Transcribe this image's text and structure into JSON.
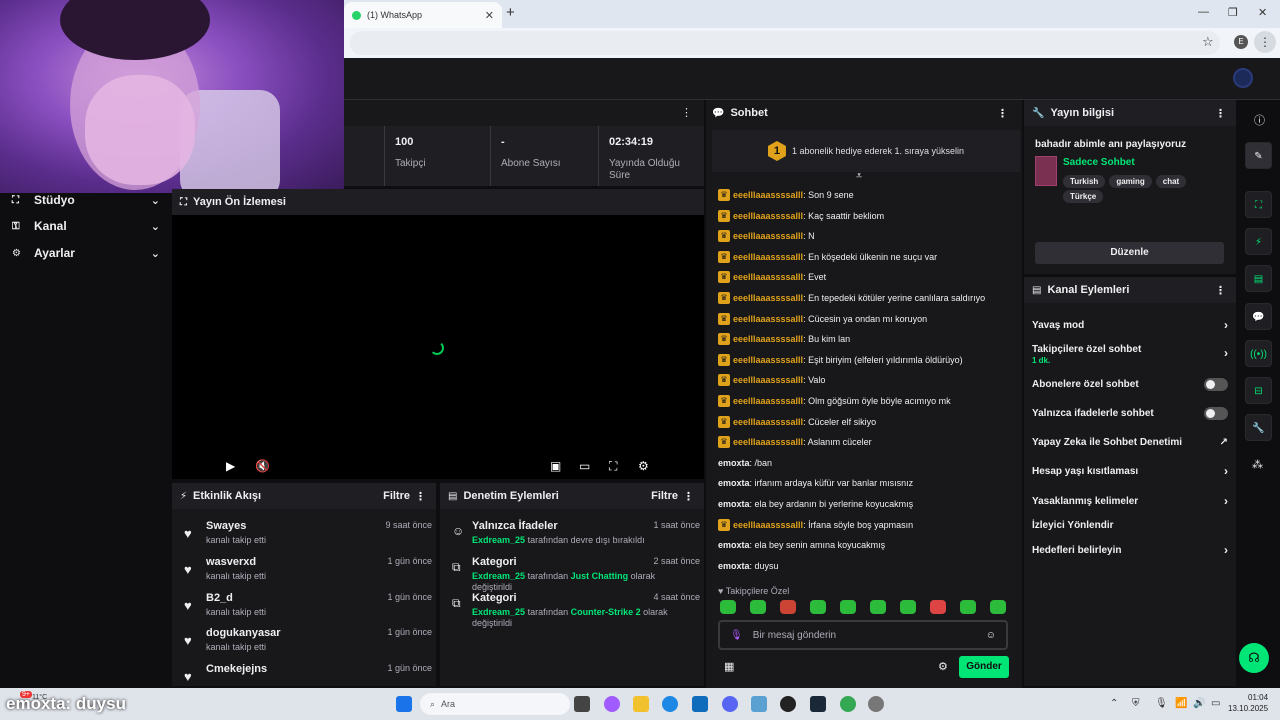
{
  "browser": {
    "tab_title": "(1) WhatsApp",
    "tab_close": "✕",
    "new_tab": "+",
    "minimize": "—",
    "restore": "❐",
    "close": "✕",
    "profile_initial": "E"
  },
  "sidebar": {
    "items": [
      {
        "label": "Stüdyo",
        "icon": "studio-icon"
      },
      {
        "label": "Kanal",
        "icon": "channel-icon"
      },
      {
        "label": "Ayarlar",
        "icon": "gear-icon"
      }
    ]
  },
  "stats": [
    {
      "value": "100",
      "label": "Takipçi"
    },
    {
      "value": "-",
      "label": "Abone Sayısı"
    },
    {
      "value": "02:34:19",
      "label": "Yayında Olduğu Süre"
    }
  ],
  "preview": {
    "title": "Yayın Ön İzlemesi"
  },
  "event_feed": {
    "title": "Etkinlik Akışı",
    "filter": "Filtre",
    "events": [
      {
        "name": "Swayes",
        "sub": "kanalı takip etti",
        "time": "9 saat önce"
      },
      {
        "name": "wasverxd",
        "sub": "kanalı takip etti",
        "time": "1 gün önce"
      },
      {
        "name": "B2_d",
        "sub": "kanalı takip etti",
        "time": "1 gün önce"
      },
      {
        "name": "dogukanyasar",
        "sub": "kanalı takip etti",
        "time": "1 gün önce"
      },
      {
        "name": "Cmekejejns",
        "sub": "",
        "time": "1 gün önce"
      }
    ]
  },
  "mod_actions": {
    "title": "Denetim Eylemleri",
    "filter": "Filtre",
    "items": [
      {
        "name": "Yalnızca İfadeler",
        "user": "Exdream_25",
        "text": "tarafından devre dışı bırakıldı",
        "extra": "",
        "extra2": "",
        "time": "1 saat önce"
      },
      {
        "name": "Kategori",
        "user": "Exdream_25",
        "text": "tarafından",
        "extra": "Just Chatting",
        "extra2": "olarak değiştirildi",
        "time": "2 saat önce"
      },
      {
        "name": "Kategori",
        "user": "Exdream_25",
        "text": "tarafından",
        "extra": "Counter-Strike 2",
        "extra2": "olarak değiştirildi",
        "time": "4 saat önce"
      }
    ]
  },
  "chat": {
    "title": "Sohbet",
    "banner_count": "1",
    "banner_text": "1 abonelik hediye ederek 1. sıraya yükselin",
    "messages": [
      {
        "user": "eeelllaaassssalll",
        "text": ": Son 9 sene",
        "sub": true
      },
      {
        "user": "eeelllaaassssalll",
        "text": ": Kaç saattir bekliom",
        "sub": true
      },
      {
        "user": "eeelllaaassssalll",
        "text": ": N",
        "sub": true
      },
      {
        "user": "eeelllaaassssalll",
        "text": ": En köşedeki ülkenin ne suçu var",
        "sub": true
      },
      {
        "user": "eeelllaaassssalll",
        "text": ": Evet",
        "sub": true
      },
      {
        "user": "eeelllaaassssalll",
        "text": ": En tepedeki kötüler yerine canlılara saldırıyo",
        "sub": true
      },
      {
        "user": "eeelllaaassssalll",
        "text": ": Cücesin ya ondan mı koruyon",
        "sub": true
      },
      {
        "user": "eeelllaaassssalll",
        "text": ": Bu kim lan",
        "sub": true
      },
      {
        "user": "eeelllaaassssalll",
        "text": ": Eşit biriyim (elfeleri yıldırımla öldürüyo)",
        "sub": true
      },
      {
        "user": "eeelllaaassssalll",
        "text": ": Valo",
        "sub": true
      },
      {
        "user": "eeelllaaassssalll",
        "text": ": Olm göğsüm öyle böyle acımıyo mk",
        "sub": true
      },
      {
        "user": "eeelllaaassssalll",
        "text": ": Cüceler elf sikiyo",
        "sub": true
      },
      {
        "user": "eeelllaaassssalll",
        "text": ": Aslanım cüceler",
        "sub": true
      },
      {
        "user": "emoxta",
        "text": ": /ban",
        "sub": false
      },
      {
        "user": "emoxta",
        "text": ": irfanım ardaya küfür var banlar mısısnız",
        "sub": false
      },
      {
        "user": "emoxta",
        "text": ": ela bey ardanın bi yerlerine koyucakmış",
        "sub": false
      },
      {
        "user": "eeelllaaassssalll",
        "text": ": İrfana söyle boş yapmasın",
        "sub": true
      },
      {
        "user": "emoxta",
        "text": ": ela bey senin amına koyucakmış",
        "sub": false
      },
      {
        "user": "emoxta",
        "text": ": duysu",
        "sub": false
      }
    ],
    "followers_only": "Takipçilere Özel",
    "placeholder": "Bir mesaj gönderin",
    "send": "Gönder"
  },
  "stream_info": {
    "title": "Yayın bilgisi",
    "stream_title": "bahadır abimle anı paylaşıyoruz",
    "category": "Sadece Sohbet",
    "tags": [
      "Turkish",
      "gaming",
      "chat",
      "Türkçe"
    ],
    "edit": "Düzenle"
  },
  "channel_actions": {
    "title": "Kanal Eylemleri",
    "rows": [
      {
        "label": "Yavaş mod",
        "kind": "chevron"
      },
      {
        "label": "Takipçilere özel sohbet",
        "kind": "chevron",
        "sub": "1 dk."
      },
      {
        "label": "Abonelere özel sohbet",
        "kind": "toggle"
      },
      {
        "label": "Yalnızca ifadelerle sohbet",
        "kind": "toggle"
      },
      {
        "label": "Yapay Zeka ile Sohbet Denetimi",
        "kind": "external"
      },
      {
        "label": "Hesap yaşı kısıtlaması",
        "kind": "chevron"
      },
      {
        "label": "Yasaklanmış kelimeler",
        "kind": "chevron"
      },
      {
        "label": "İzleyici Yönlendir",
        "kind": "none"
      },
      {
        "label": "Hedefleri belirleyin",
        "kind": "chevron"
      }
    ]
  },
  "taskbar": {
    "search": "Ara",
    "time": "01:04",
    "date": "13.10.2025",
    "weather": "11°C"
  },
  "overlay": {
    "text": "emoxta: duysu",
    "badge": "9+"
  },
  "colors": {
    "accent": "#00e676",
    "sub_gold": "#e0a21b",
    "bg": "#0e0e10",
    "panel": "#18181b"
  }
}
